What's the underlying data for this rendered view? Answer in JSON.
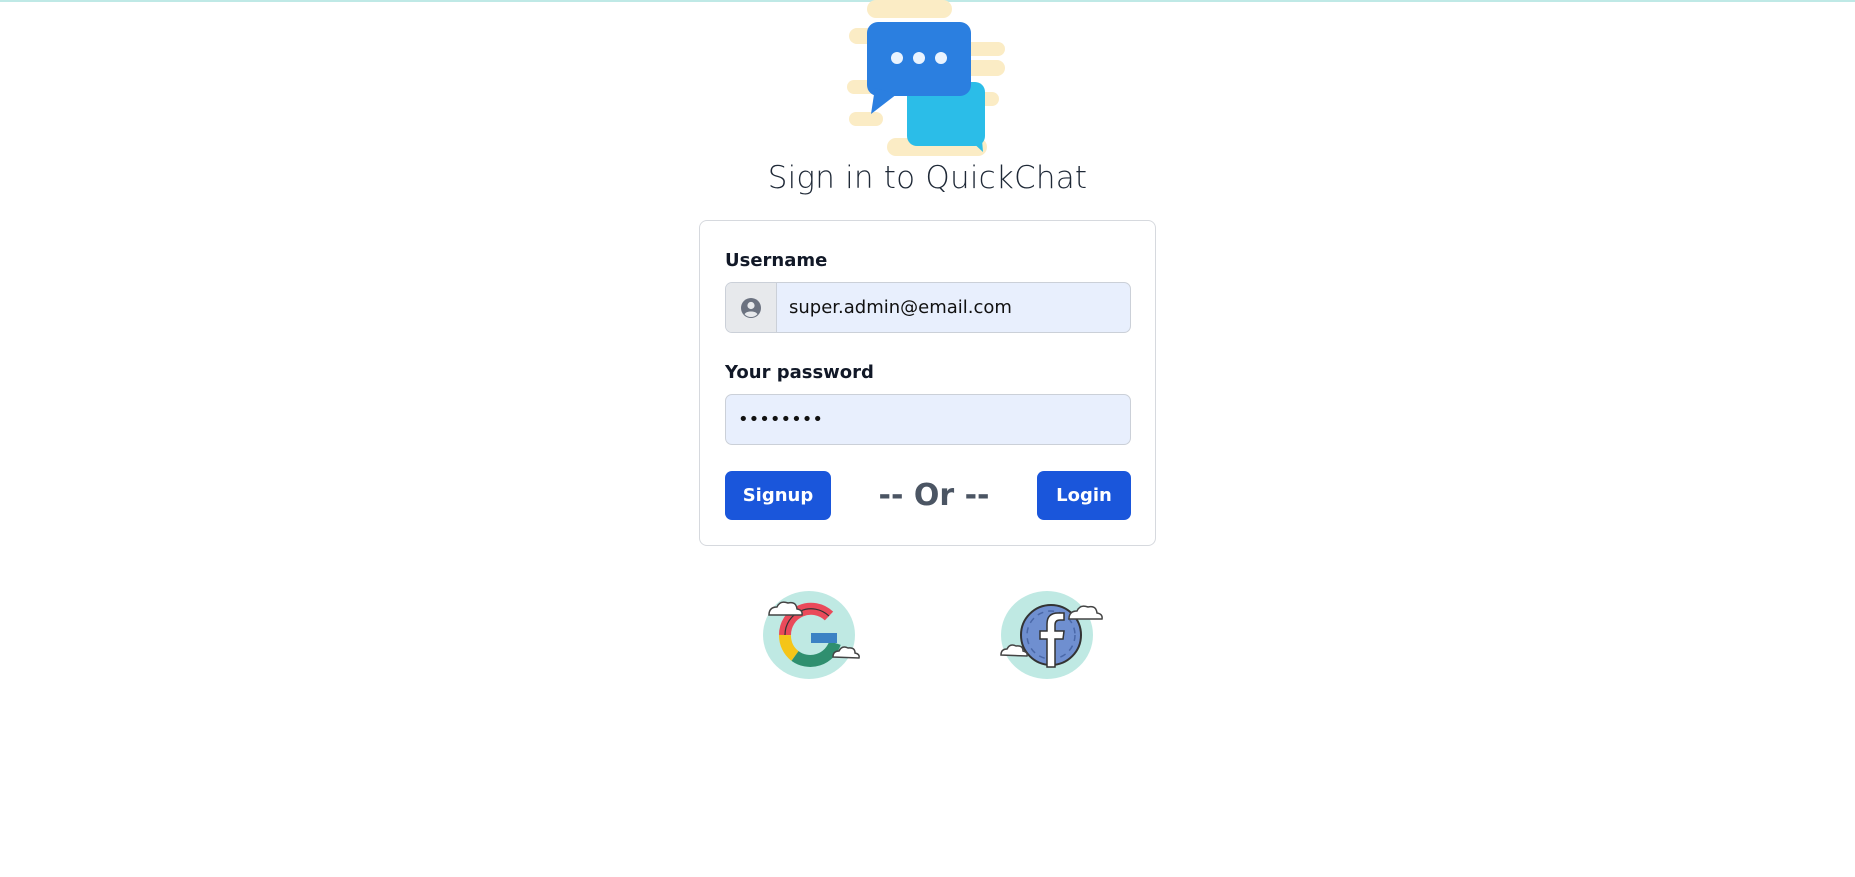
{
  "app": {
    "title": "Sign in to QuickChat"
  },
  "form": {
    "username_label": "Username",
    "username_value": "super.admin@email.com",
    "password_label": "Your password",
    "password_value": "••••••••"
  },
  "actions": {
    "signup_label": "Signup",
    "or_text": "-- Or --",
    "login_label": "Login"
  },
  "icons": {
    "logo": "chat-bubbles-logo",
    "username_addon": "user-circle-icon",
    "google": "google-icon",
    "facebook": "facebook-icon"
  },
  "colors": {
    "primary": "#1a56db",
    "input_bg": "#e8effd",
    "logo_blue_dark": "#2b7fe0",
    "logo_blue_light": "#2bbde8",
    "logo_cream": "#fbecc5",
    "social_cloud": "#bfe9e3"
  }
}
